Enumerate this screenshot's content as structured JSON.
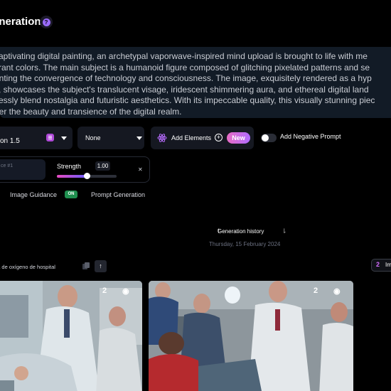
{
  "header": {
    "title": "eneration"
  },
  "prompt": {
    "lines": [
      "captivating digital painting, an archetypal vaporwave-inspired mind upload is brought to life with me",
      "rant colors. The main subject is a humanoid figure composed of glitching pixelated patterns and se",
      "enting the convergence of technology and consciousness. The image, exquisitely rendered as a hyp",
      "k, showcases the subject's translucent visage, iridescent shimmering aura, and ethereal digital land",
      "essly blend nostalgia and futuristic aesthetics. With its impeccable quality, this visually stunning piec",
      "der the beauty and transience of the digital realm."
    ]
  },
  "controls": {
    "model": "on 1.5",
    "style": "None",
    "add_elements": "Add Elements",
    "new_badge": "New",
    "negative_prompt": "Add Negative Prompt"
  },
  "image_guidance": {
    "reference_placeholder": "ce #1",
    "strength_label": "Strength",
    "strength_value": "1.00",
    "strength_fraction": 0.5
  },
  "tabs": {
    "image_guidance": "Image Guidance",
    "on_badge": "ON",
    "prompt_generation": "Prompt Generation"
  },
  "history": {
    "title": "Generation history",
    "date": "Thursday, 15 February 2024"
  },
  "generation": {
    "title": "na de oxígeno de hospital",
    "image_button": "Im"
  },
  "colors": {
    "accent": "#9b6cff",
    "on_green": "#1f8f4f",
    "prompt_bg": "#121b26"
  }
}
